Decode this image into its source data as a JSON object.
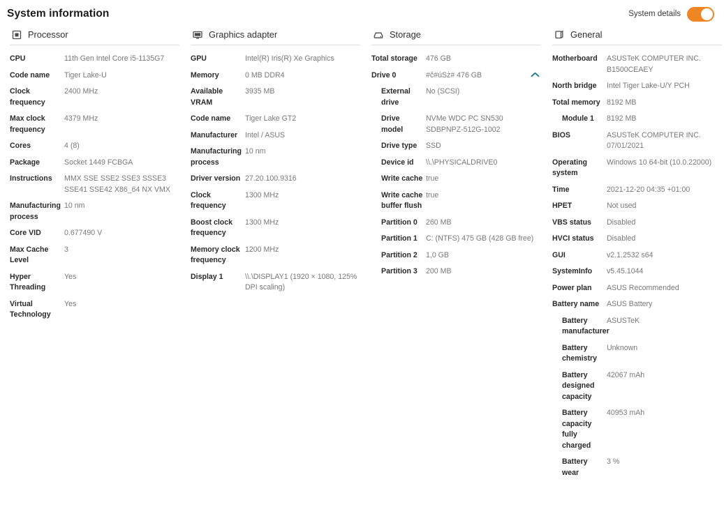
{
  "header": {
    "title": "System information",
    "toggle_label": "System details",
    "toggle_state": "on",
    "toggle_color": "#ee8623"
  },
  "columns": [
    {
      "id": "processor",
      "title": "Processor",
      "icon": "cpu-chip-icon",
      "rows": [
        {
          "label": "CPU",
          "value": "11th Gen Intel Core i5-1135G7"
        },
        {
          "label": "Code name",
          "value": "Tiger Lake-U"
        },
        {
          "label": "Clock frequency",
          "value": "2400 MHz"
        },
        {
          "label": "Max clock frequency",
          "value": "4379 MHz"
        },
        {
          "label": "Cores",
          "value": "4 (8)"
        },
        {
          "label": "Package",
          "value": "Socket 1449 FCBGA"
        },
        {
          "label": "Instructions",
          "value": "MMX SSE SSE2 SSE3 SSSE3 SSE41 SSE42 X86_64 NX VMX"
        },
        {
          "label": "Manufacturing process",
          "value": "10 nm"
        },
        {
          "label": "Core VID",
          "value": "0.677490 V"
        },
        {
          "label": "Max Cache Level",
          "value": "3"
        },
        {
          "label": "Hyper Threading",
          "value": "Yes"
        },
        {
          "label": "Virtual Technology",
          "value": "Yes"
        }
      ]
    },
    {
      "id": "graphics-adapter",
      "title": "Graphics adapter",
      "icon": "monitor-icon",
      "rows": [
        {
          "label": "GPU",
          "value": "Intel(R) Iris(R) Xe Graphics"
        },
        {
          "label": "Memory",
          "value": "0 MB DDR4"
        },
        {
          "label": "Available VRAM",
          "value": "3935 MB"
        },
        {
          "label": "Code name",
          "value": "Tiger Lake GT2"
        },
        {
          "label": "Manufacturer",
          "value": "Intel / ASUS"
        },
        {
          "label": "Manufacturing process",
          "value": "10 nm"
        },
        {
          "label": "Driver version",
          "value": "27.20.100.9316"
        },
        {
          "label": "Clock frequency",
          "value": "1300 MHz"
        },
        {
          "label": "Boost clock frequency",
          "value": "1300 MHz"
        },
        {
          "label": "Memory clock frequency",
          "value": "1200 MHz"
        },
        {
          "label": "Display 1",
          "value": "\\\\.\\DISPLAY1 (1920 × 1080, 125% DPI scaling)"
        }
      ]
    },
    {
      "id": "storage",
      "title": "Storage",
      "icon": "hard-drive-icon",
      "rows": [
        {
          "label": "Total storage",
          "value": "476 GB"
        },
        {
          "label": "Drive 0",
          "value": "#č#úSż# 476 GB",
          "chevron": "up",
          "chevron_color": "#1b7d8e"
        },
        {
          "label": "External drive",
          "value": "No (SCSI)",
          "indent": true
        },
        {
          "label": "Drive model",
          "value": "NVMe WDC PC SN530 SDBPNPZ-512G-1002",
          "indent": true
        },
        {
          "label": "Drive type",
          "value": "SSD",
          "indent": true
        },
        {
          "label": "Device id",
          "value": "\\\\.\\PHYSICALDRIVE0",
          "indent": true
        },
        {
          "label": "Write cache",
          "value": "true",
          "indent": true
        },
        {
          "label": "Write cache buffer flush",
          "value": "true",
          "indent": true
        },
        {
          "label": "Partition 0",
          "value": "260 MB",
          "indent": true
        },
        {
          "label": "Partition 1",
          "value": "C: (NTFS) 475 GB (428 GB free)",
          "indent": true
        },
        {
          "label": "Partition 2",
          "value": "1,0 GB",
          "indent": true
        },
        {
          "label": "Partition 3",
          "value": "200 MB",
          "indent": true
        }
      ]
    },
    {
      "id": "general",
      "title": "General",
      "icon": "desktop-tower-icon",
      "rows": [
        {
          "label": "Motherboard",
          "value": "ASUSTeK COMPUTER INC. B1500CEAEY"
        },
        {
          "label": "North bridge",
          "value": "Intel Tiger Lake-U/Y PCH"
        },
        {
          "label": "Total memory",
          "value": "8192 MB"
        },
        {
          "label": "Module 1",
          "value": "8192 MB",
          "indent": true
        },
        {
          "label": "BIOS",
          "value": "ASUSTeK COMPUTER INC. 07/01/2021"
        },
        {
          "label": "Operating system",
          "value": "Windows 10 64-bit (10.0.22000)"
        },
        {
          "label": "Time",
          "value": "2021-12-20 04:35 +01:00"
        },
        {
          "label": "HPET",
          "value": "Not used"
        },
        {
          "label": "VBS status",
          "value": "Disabled"
        },
        {
          "label": "HVCI status",
          "value": "Disabled"
        },
        {
          "label": "GUI",
          "value": "v2.1.2532 s64"
        },
        {
          "label": "SystemInfo",
          "value": "v5.45.1044"
        },
        {
          "label": "Power plan",
          "value": "ASUS Recommended"
        },
        {
          "label": "Battery name",
          "value": "ASUS Battery"
        },
        {
          "label": "Battery manufacturer",
          "value": "ASUSTeK",
          "indent": true
        },
        {
          "label": "Battery chemistry",
          "value": "Unknown",
          "indent": true
        },
        {
          "label": "Battery designed capacity",
          "value": "42067 mAh",
          "indent": true
        },
        {
          "label": "Battery capacity fully charged",
          "value": "40953 mAh",
          "indent": true
        },
        {
          "label": "Battery wear",
          "value": "3 %",
          "indent": true
        }
      ]
    }
  ]
}
